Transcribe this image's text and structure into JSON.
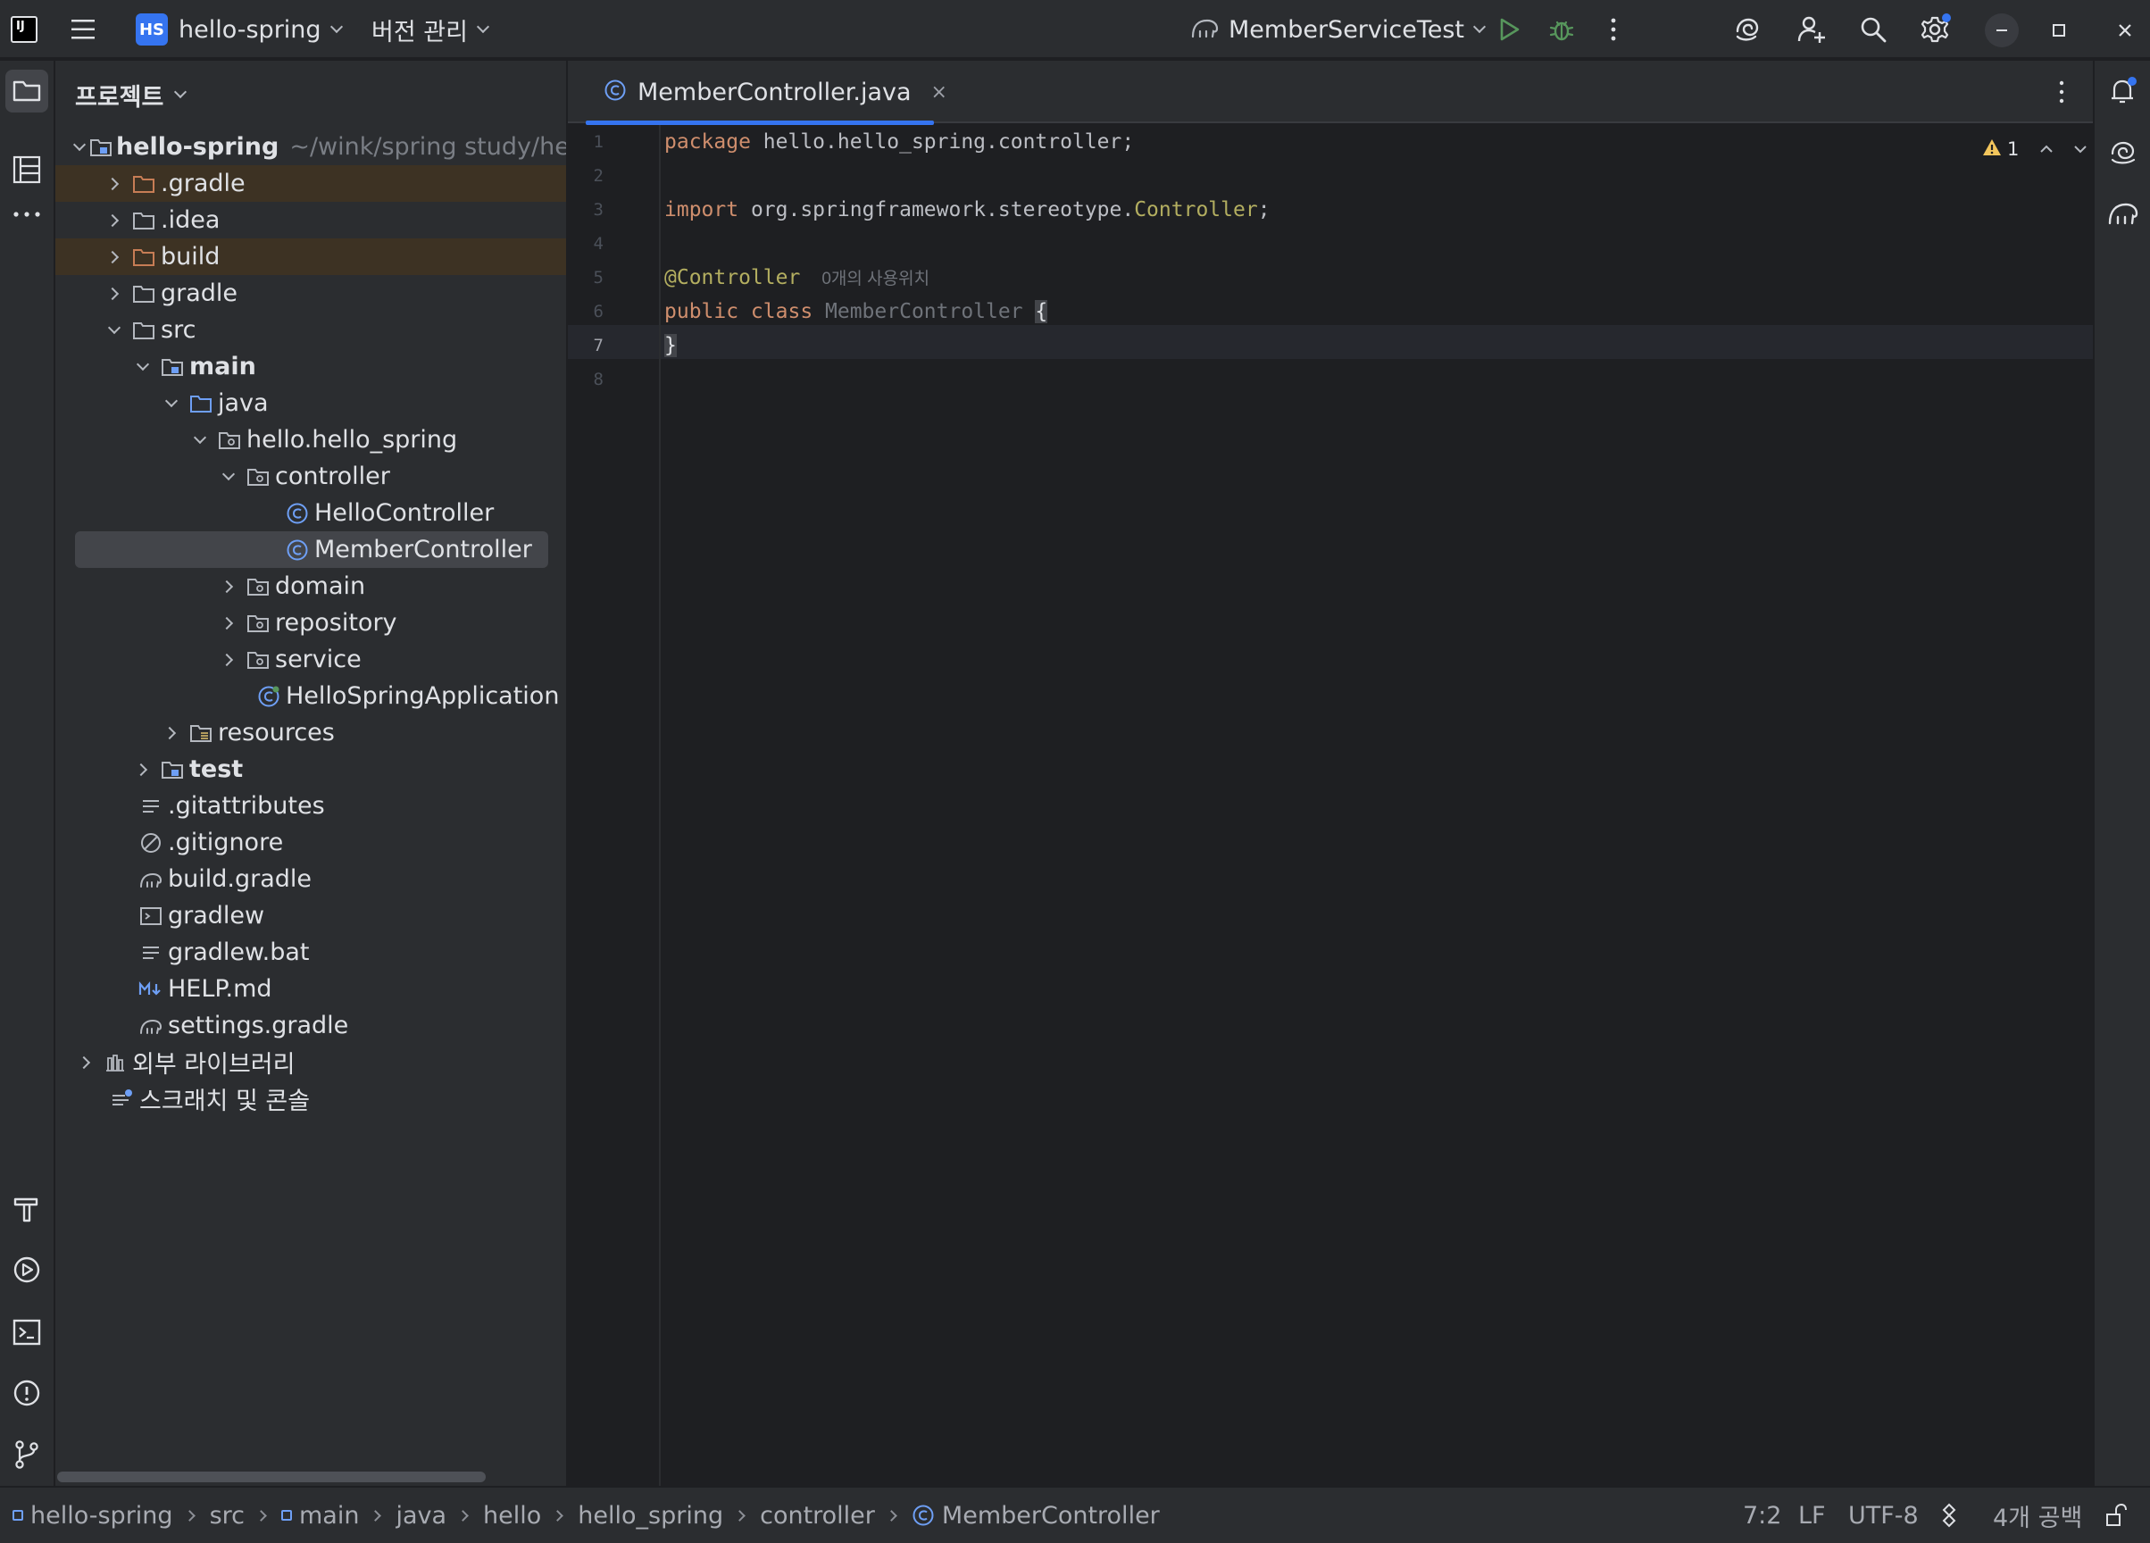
{
  "titlebar": {
    "project_badge": "HS",
    "project_name": "hello-spring",
    "vcs_menu": "버전 관리",
    "run_config": "MemberServiceTest"
  },
  "project_panel": {
    "title": "프로젝트",
    "root_path": "~/wink/spring study/hello-",
    "items": [
      {
        "label": "hello-spring"
      },
      {
        "label": ".gradle"
      },
      {
        "label": ".idea"
      },
      {
        "label": "build"
      },
      {
        "label": "gradle"
      },
      {
        "label": "src"
      },
      {
        "label": "main"
      },
      {
        "label": "java"
      },
      {
        "label": "hello.hello_spring"
      },
      {
        "label": "controller"
      },
      {
        "label": "HelloController"
      },
      {
        "label": "MemberController"
      },
      {
        "label": "domain"
      },
      {
        "label": "repository"
      },
      {
        "label": "service"
      },
      {
        "label": "HelloSpringApplication"
      },
      {
        "label": "resources"
      },
      {
        "label": "test"
      },
      {
        "label": ".gitattributes"
      },
      {
        "label": ".gitignore"
      },
      {
        "label": "build.gradle"
      },
      {
        "label": "gradlew"
      },
      {
        "label": "gradlew.bat"
      },
      {
        "label": "HELP.md"
      },
      {
        "label": "settings.gradle"
      },
      {
        "label": "외부 라이브러리"
      },
      {
        "label": "스크래치 및 콘솔"
      }
    ]
  },
  "editor": {
    "tab_label": "MemberController.java",
    "tab_close": "×",
    "line_numbers": [
      "1",
      "2",
      "3",
      "4",
      "5",
      "6",
      "7",
      "8"
    ],
    "code": {
      "l1_kw": "package",
      "l1_rest": " hello.hello_spring.controller;",
      "l3_kw": "import",
      "l3_pkg": " org.springframework.stereotype.",
      "l3_cls": "Controller",
      "l3_end": ";",
      "l5_ann": "@Controller",
      "l5_hint": "0개의 사용위치",
      "l6_kw": "public class",
      "l6_cls": " MemberController ",
      "l6_brace": "{",
      "l7_brace": "}"
    },
    "warning_count": "1"
  },
  "statusbar": {
    "breadcrumbs": [
      "hello-spring",
      "src",
      "main",
      "java",
      "hello",
      "hello_spring",
      "controller",
      "MemberController"
    ],
    "position": "7:2",
    "line_sep": "LF",
    "encoding": "UTF-8",
    "indent": "4개 공백"
  },
  "colors": {
    "accent": "#3574f0",
    "keyword": "#cf8e6d",
    "annotation": "#b3ae60",
    "run_green": "#57965c"
  }
}
